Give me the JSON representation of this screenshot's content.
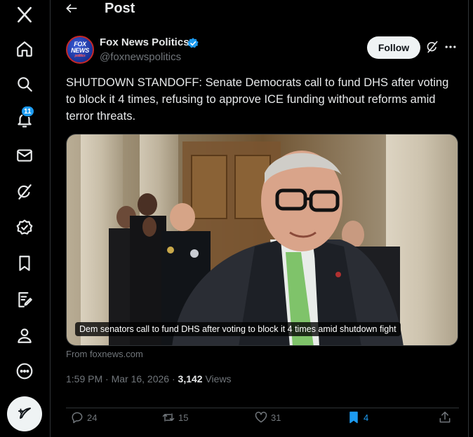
{
  "nav": {
    "items": [
      {
        "name": "x-logo-icon"
      },
      {
        "name": "home-icon"
      },
      {
        "name": "search-icon"
      },
      {
        "name": "notifications-icon",
        "badge": "11"
      },
      {
        "name": "messages-icon"
      },
      {
        "name": "grok-icon"
      },
      {
        "name": "verified-orgs-icon"
      },
      {
        "name": "bookmarks-icon"
      },
      {
        "name": "articles-icon"
      },
      {
        "name": "profile-icon"
      },
      {
        "name": "more-icon"
      }
    ],
    "compose_icon": "compose-icon"
  },
  "header": {
    "title": "Post"
  },
  "post": {
    "author_name": "Fox News Politics",
    "handle": "@foxnewspolitics",
    "avatar_line1": "FOX",
    "avatar_line2": "NEWS",
    "avatar_line3": "politics",
    "follow_label": "Follow",
    "text": "SHUTDOWN STANDOFF: Senate Democrats call to fund DHS after voting to block it 4 times, refusing to approve ICE funding without reforms amid terror threats.",
    "media_caption": "Dem senators call to fund DHS after voting to block it 4 times amid shutdown fight",
    "source": "From foxnews.com",
    "timestamp": "1:59 PM · Mar 16, 2026 · ",
    "views_count": "3,142",
    "views_label": " Views"
  },
  "actions": {
    "replies": "24",
    "reposts": "15",
    "likes": "31",
    "bookmarks": "4"
  },
  "colors": {
    "accent": "#1d9bf0",
    "background": "#000000",
    "muted": "#71767b"
  }
}
